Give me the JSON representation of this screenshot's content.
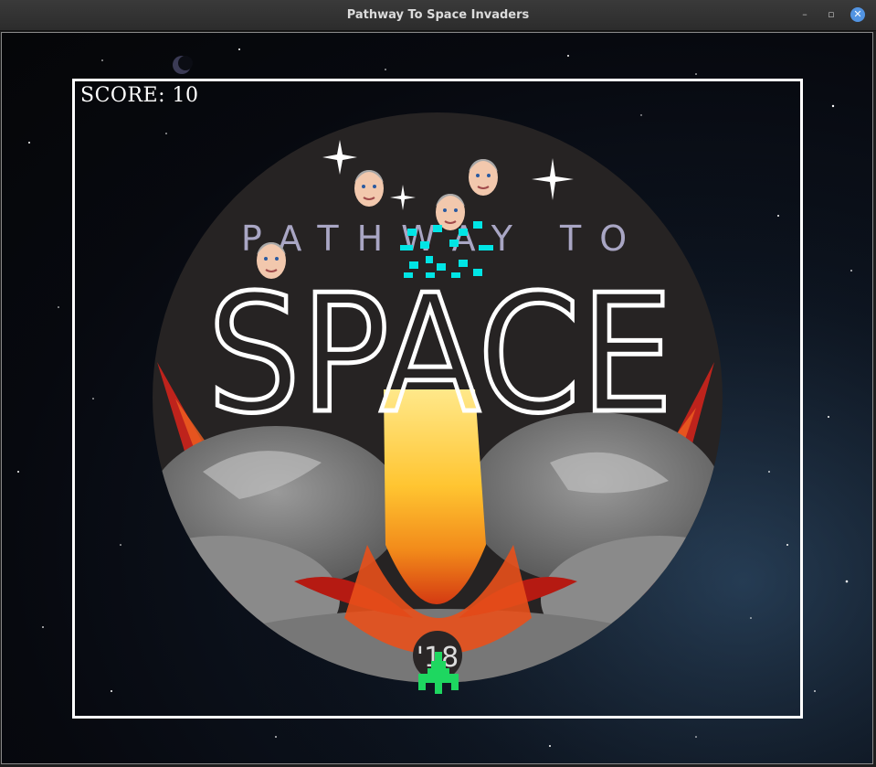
{
  "window": {
    "title": "Pathway To Space Invaders",
    "buttons": {
      "minimize": "–",
      "maximize": "▫",
      "close": "✕"
    }
  },
  "hud": {
    "score_label": "SCORE: 10"
  },
  "logo": {
    "line1": "PATHWAY TO",
    "line2": "SPACE",
    "year": "'18"
  },
  "colors": {
    "playfield_border": "#ffffff",
    "alien": "#00e5e5",
    "player_ship": "#1ed760",
    "logo_disc": "#262323",
    "flame_yellow": "#ffd94a",
    "flame_red": "#d9231b"
  },
  "sprites": {
    "enemy_faces": 4,
    "explosion_icon": "pixel-explosion",
    "player_icon": "pixel-ship"
  }
}
